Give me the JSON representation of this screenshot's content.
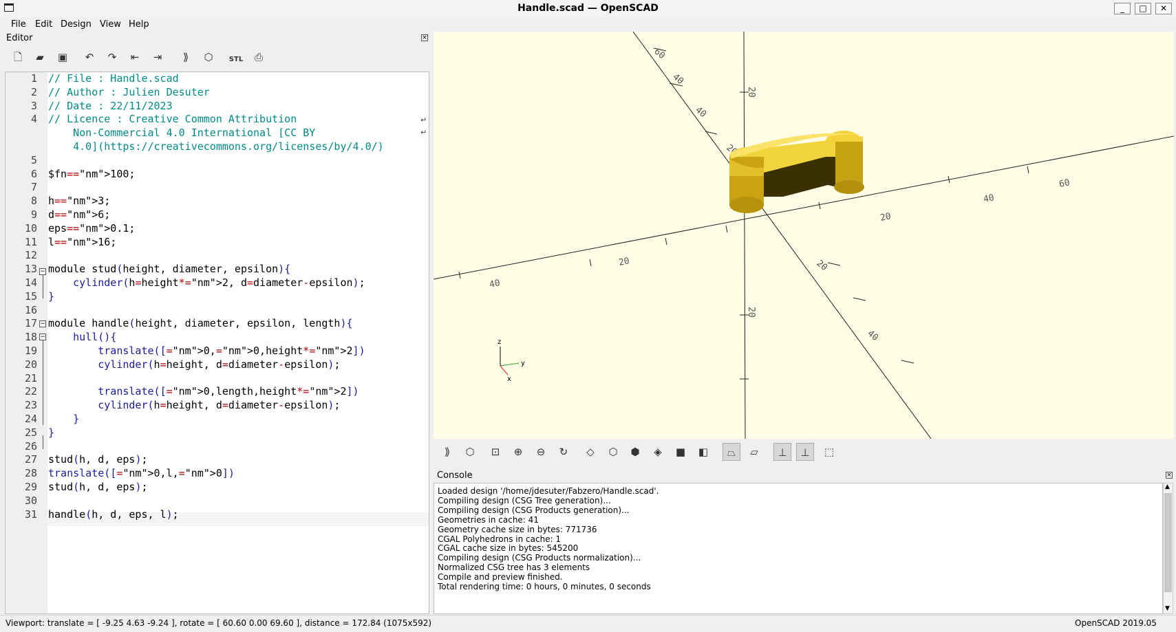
{
  "window": {
    "title": "Handle.scad — OpenSCAD",
    "buttons": [
      "_",
      "□",
      "✕"
    ]
  },
  "menu": [
    "File",
    "Edit",
    "Design",
    "View",
    "Help"
  ],
  "editor": {
    "title": "Editor",
    "toolbar_icons": [
      "new-file-icon",
      "open-file-icon",
      "save-icon",
      "undo-icon",
      "redo-icon",
      "unindent-icon",
      "indent-icon",
      "preview-icon",
      "render-icon",
      "export-stl-icon",
      "send-to-print-icon"
    ],
    "stl_label": "STL",
    "line_numbers": [
      "1",
      "2",
      "3",
      "4",
      "",
      "",
      "5",
      "6",
      "7",
      "8",
      "9",
      "10",
      "11",
      "12",
      "13",
      "14",
      "15",
      "16",
      "17",
      "18",
      "19",
      "20",
      "21",
      "22",
      "23",
      "24",
      "25",
      "26",
      "27",
      "28",
      "29",
      "30",
      "31"
    ],
    "code_lines": [
      "// File : Handle.scad",
      "// Author : Julien Desuter",
      "// Date : 22/11/2023",
      "// Licence : Creative Common Attribution",
      "    Non-Commercial 4.0 International [CC BY",
      "    4.0](https://creativecommons.org/licenses/by/4.0/)",
      "",
      "$fn=100;",
      "",
      "h=3;",
      "d=6;",
      "eps=0.1;",
      "l=16;",
      "",
      "module stud(height, diameter, epsilon){",
      "    cylinder(h=height*2, d=diameter-epsilon);",
      "}",
      "",
      "module handle(height, diameter, epsilon, length){",
      "    hull(){",
      "        translate([0,0,height*2])",
      "        cylinder(h=height, d=diameter-epsilon);",
      "",
      "        translate([0,length,height*2])",
      "        cylinder(h=height, d=diameter-epsilon);",
      "    }",
      "}",
      "",
      "stud(h, d, eps);",
      "translate([0,l,0])",
      "stud(h, d, eps);",
      "",
      "handle(h, d, eps, l);"
    ]
  },
  "viewport": {
    "axis_labels": {
      "x": "x",
      "y": "y",
      "z": "z"
    },
    "model_color": "#f5d33a"
  },
  "view_toolbar_icons": [
    "preview-icon",
    "render-icon",
    "view-all-icon",
    "zoom-in-icon",
    "zoom-out-icon",
    "reset-view-icon",
    "view-right-icon",
    "view-top-icon",
    "view-bottom-icon",
    "view-left-icon",
    "view-front-icon",
    "view-back-icon",
    "perspective-icon",
    "orthogonal-icon",
    "show-axes-icon",
    "show-scale-markers-icon",
    "show-edges-icon"
  ],
  "console": {
    "title": "Console",
    "lines": [
      "Loaded design '/home/jdesuter/Fabzero/Handle.scad'.",
      "Compiling design (CSG Tree generation)...",
      "Compiling design (CSG Products generation)...",
      "Geometries in cache: 41",
      "Geometry cache size in bytes: 771736",
      "CGAL Polyhedrons in cache: 1",
      "CGAL cache size in bytes: 545200",
      "Compiling design (CSG Products normalization)...",
      "Normalized CSG tree has 3 elements",
      "Compile and preview finished.",
      "Total rendering time: 0 hours, 0 minutes, 0 seconds"
    ]
  },
  "status": {
    "viewport_info": "Viewport: translate = [ -9.25 4.63 -9.24 ], rotate = [ 60.60 0.00 69.60 ], distance = 172.84 (1075x592)",
    "version": "OpenSCAD 2019.05"
  }
}
